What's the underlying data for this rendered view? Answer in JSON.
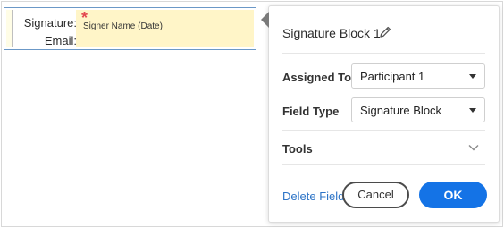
{
  "form": {
    "signature_label": "Signature:",
    "email_label": "Email:",
    "required_marker": "*",
    "signer_placeholder": "Signer Name (Date)"
  },
  "popover": {
    "title": "Signature Block 1",
    "edit_icon": "pencil-icon",
    "assigned_to": {
      "label": "Assigned To",
      "value": "Participant 1"
    },
    "field_type": {
      "label": "Field Type",
      "value": "Signature Block"
    },
    "tools": {
      "label": "Tools",
      "icon": "chevron-down-icon"
    },
    "delete_label": "Delete Field",
    "cancel_label": "Cancel",
    "ok_label": "OK"
  },
  "colors": {
    "accent": "#1473e6",
    "link": "#2d74c7",
    "required": "#e34850",
    "field_fill": "#fff5c8"
  }
}
